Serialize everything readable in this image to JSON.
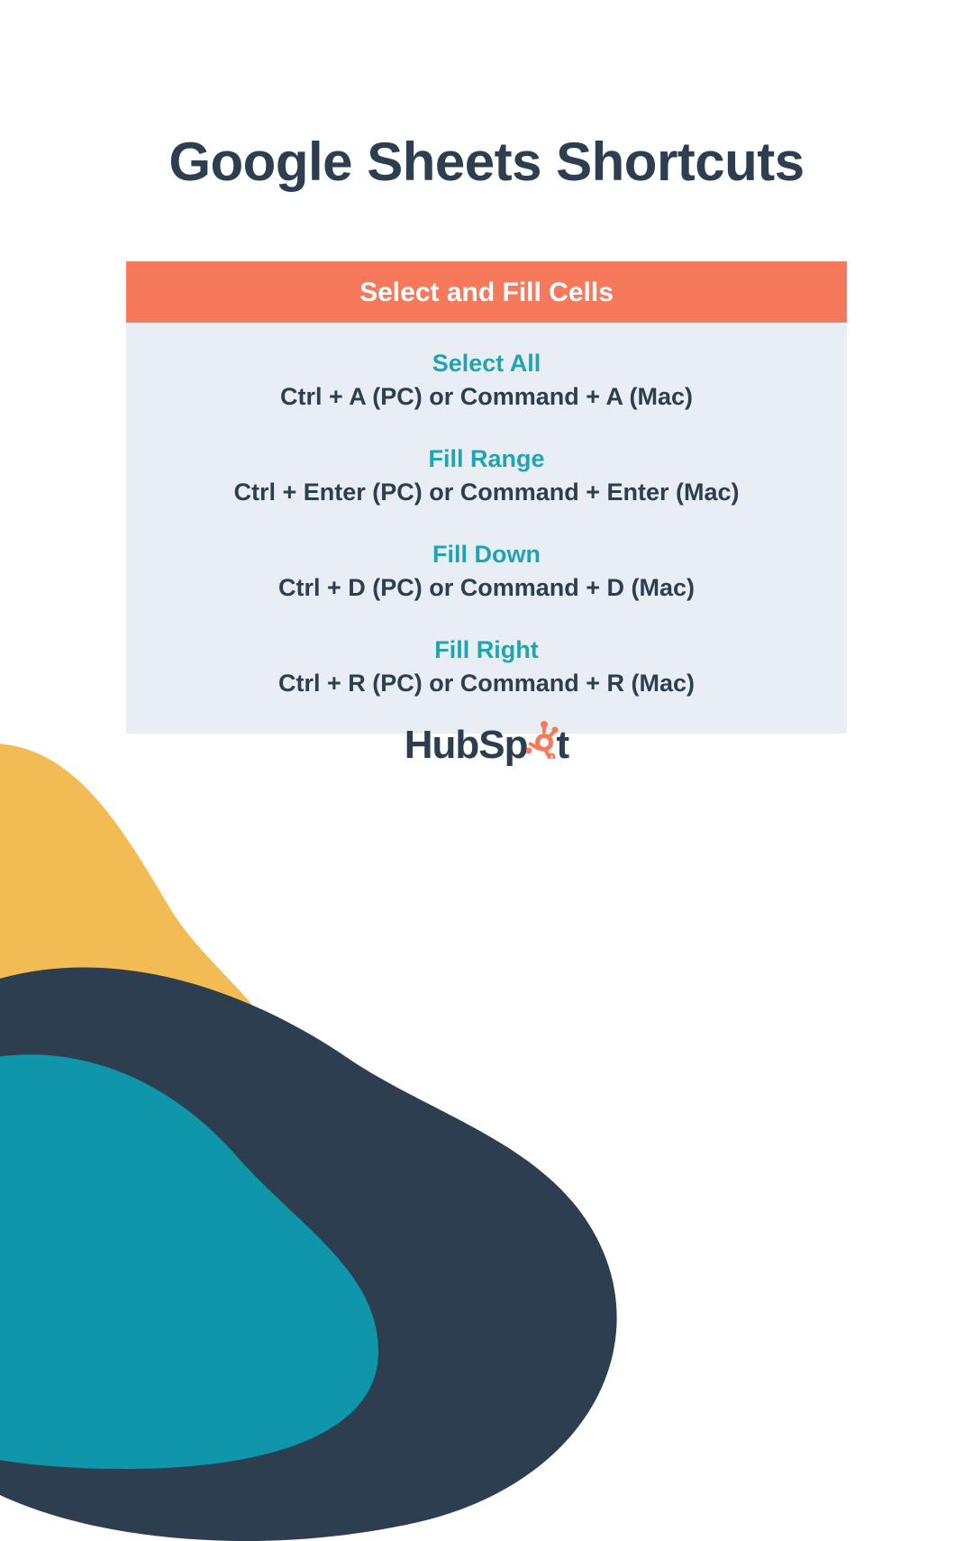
{
  "title": "Google Sheets Shortcuts",
  "card": {
    "header": "Select and Fill Cells",
    "items": [
      {
        "name": "Select All",
        "keys": "Ctrl + A (PC) or Command + A (Mac)"
      },
      {
        "name": "Fill Range",
        "keys": "Ctrl + Enter (PC) or Command + Enter (Mac)"
      },
      {
        "name": "Fill Down",
        "keys": "Ctrl + D (PC) or Command + D (Mac)"
      },
      {
        "name": "Fill Right",
        "keys": "Ctrl + R (PC) or Command + R (Mac)"
      }
    ]
  },
  "brand": {
    "prefix": "HubSp",
    "suffix": "t"
  },
  "colors": {
    "navy": "#2d3e50",
    "coral": "#f5795a",
    "teal_text": "#1ea4b5",
    "panel": "#e9eef4",
    "blob_yellow": "#f3bb53",
    "blob_teal": "#0f96aa",
    "sprocket": "#f5795a"
  }
}
